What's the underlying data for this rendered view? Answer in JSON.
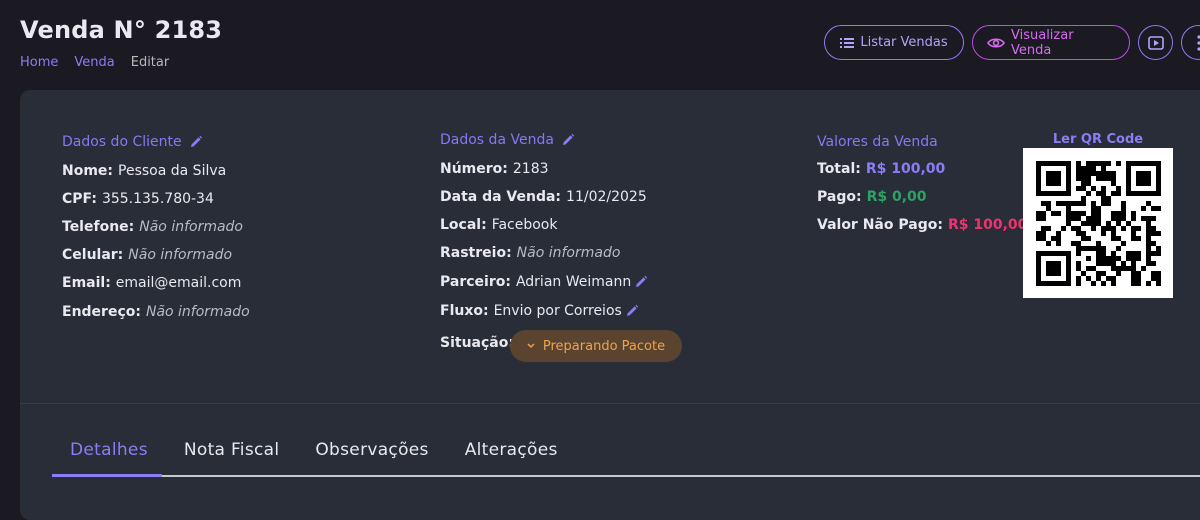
{
  "header": {
    "title": "Venda N° 2183",
    "breadcrumb": [
      "Home",
      "Venda",
      "Editar"
    ]
  },
  "actions": {
    "list_label": "Listar Vendas",
    "view_label": "Visualizar Venda"
  },
  "cliente": {
    "title": "Dados do Cliente",
    "fields": [
      {
        "label": "Nome:",
        "value": "Pessoa da Silva"
      },
      {
        "label": "CPF:",
        "value": "355.135.780-34"
      },
      {
        "label": "Telefone:",
        "value": "Não informado"
      },
      {
        "label": "Celular:",
        "value": "Não informado"
      },
      {
        "label": "Email:",
        "value": "email@email.com"
      },
      {
        "label": "Endereço:",
        "value": "Não informado"
      }
    ]
  },
  "venda": {
    "title": "Dados da Venda",
    "fields": [
      {
        "label": "Número:",
        "value": "2183"
      },
      {
        "label": "Data da Venda:",
        "value": "11/02/2025"
      },
      {
        "label": "Local:",
        "value": "Facebook"
      },
      {
        "label": "Rastreio:",
        "value": "Não informado"
      },
      {
        "label": "Parceiro:",
        "value": "Adrian Weimann"
      },
      {
        "label": "Fluxo:",
        "value": "Envio por Correios"
      },
      {
        "label": "Situação:",
        "value": "Preparando Pacote"
      }
    ]
  },
  "valores": {
    "title": "Valores da Venda",
    "fields": [
      {
        "label": "Total:",
        "value": "R$ 100,00"
      },
      {
        "label": "Pago:",
        "value": "R$ 0,00"
      },
      {
        "label": "Valor Não Pago:",
        "value": "R$ 100,00"
      }
    ]
  },
  "qr": {
    "title": "Ler QR Code"
  },
  "tabs": [
    "Detalhes",
    "Nota Fiscal",
    "Observações",
    "Alterações"
  ],
  "colors": {
    "accent": "#8c7cf5",
    "paid": "#2ea164",
    "unpaid": "#f1326c",
    "status": "#f0a24a"
  }
}
